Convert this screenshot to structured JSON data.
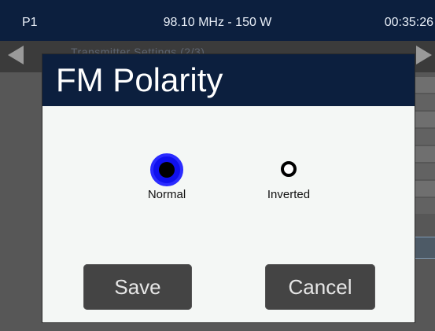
{
  "status_bar": {
    "preset": "P1",
    "frequency_power": "98.10 MHz - 150 W",
    "clock": "00:35:26"
  },
  "background_screen": {
    "title": "Transmitter Settings (2/3)"
  },
  "dialog": {
    "title": "FM Polarity",
    "options": [
      {
        "label": "Normal",
        "selected": true
      },
      {
        "label": "Inverted",
        "selected": false
      }
    ],
    "save_label": "Save",
    "cancel_label": "Cancel"
  },
  "colors": {
    "header_bg": "#0c1f3e",
    "dialog_bg": "#f4f7f5",
    "selected_radio": "#1010ee",
    "button_bg": "#444444"
  },
  "icons": {
    "nav_left": "triangle-left-icon",
    "nav_right": "triangle-right-icon",
    "radio_selected": "radio-selected-icon",
    "radio_unselected": "radio-unselected-icon"
  }
}
